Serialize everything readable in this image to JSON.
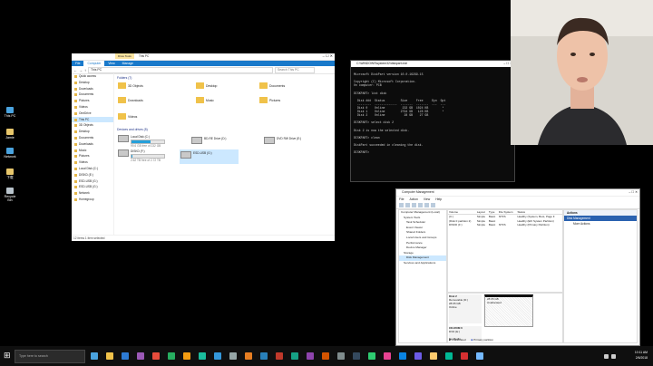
{
  "desktop": {
    "icons": [
      {
        "label": "This PC",
        "color": "#4aa3df"
      },
      {
        "label": "Jamie",
        "color": "#e7c66b"
      },
      {
        "label": "Network",
        "color": "#4aa3df"
      },
      {
        "label": "下载",
        "color": "#e7c66b"
      },
      {
        "label": "Recycle Bin",
        "color": "#b9c4cc"
      }
    ]
  },
  "explorer": {
    "title": "This PC",
    "ribbon_tabs": [
      "File",
      "Computer",
      "View",
      "Manage"
    ],
    "drive_tools_label": "Drive Tools",
    "address": "This PC",
    "search_placeholder": "Search This PC",
    "nav": [
      "Quick access",
      "Desktop",
      "Downloads",
      "Documents",
      "Pictures",
      "Videos",
      "OneDrive",
      "This PC",
      "3D Objects",
      "Desktop",
      "Documents",
      "Downloads",
      "Music",
      "Pictures",
      "Videos",
      "Local Disk (C:)",
      "DISKD (E:)",
      "ESD-USB (G:)",
      "ESD-USB (G:)",
      "Network",
      "Homegroup"
    ],
    "folders_header": "Folders (7)",
    "folders": [
      "3D Objects",
      "Desktop",
      "Documents",
      "Downloads",
      "Music",
      "Pictures",
      "Videos"
    ],
    "devices_header": "Devices and drives (5)",
    "drives": [
      {
        "name": "Local Disk (C:)",
        "free": "99.6 GB free of 232 GB",
        "fill": 0.57
      },
      {
        "name": "BD-RE Drive (D:)",
        "free": "",
        "fill": null
      },
      {
        "name": "DVD RW Drive (E:)",
        "free": "",
        "fill": null
      },
      {
        "name": "DISKD (F:)",
        "free": "2.62 TB free of 2.72 TB",
        "fill": 0.04
      },
      {
        "name": "ESD-USB (G:)",
        "free": "",
        "fill": null
      }
    ],
    "status": "12 items    1 item selected"
  },
  "cmd": {
    "title": "C:\\WINDOWS\\system32\\diskpart.exe",
    "lines": [
      "",
      "Microsoft DiskPart version 10.0.16299.15",
      "",
      "Copyright (C) Microsoft Corporation.",
      "On computer: PCB",
      "",
      "DISKPART> list disk",
      "",
      "  Disk ###  Status         Size     Free     Dyn  Gpt",
      "  --------  -------------  -------  -------  ---  ---",
      "  Disk 0    Online          232 GB  1024 KB        *",
      "  Disk 1    Online         2794 GB   128 KB        *",
      "  Disk 2    Online           28 GB    27 GB",
      "",
      "DISKPART> select disk 2",
      "",
      "Disk 2 is now the selected disk.",
      "",
      "DISKPART> clean",
      "",
      "DiskPart succeeded in cleaning the disk.",
      "",
      "DISKPART> "
    ]
  },
  "comp_mgmt": {
    "title": "Computer Management",
    "menu": [
      "File",
      "Action",
      "View",
      "Help"
    ],
    "tree": [
      "Computer Management (Local)",
      "System Tools",
      "Task Scheduler",
      "Event Viewer",
      "Shared Folders",
      "Local Users and Groups",
      "Performance",
      "Device Manager",
      "Storage",
      "Disk Management",
      "Services and Applications"
    ],
    "columns": [
      "Volume",
      "Layout",
      "Type",
      "File System",
      "Status"
    ],
    "rows": [
      [
        "(C:)",
        "Simple",
        "Basic",
        "NTFS",
        "Healthy (System, Boot, Page F"
      ],
      [
        "(Disk 0 partition 2)",
        "Simple",
        "Basic",
        "",
        "Healthy (EFI System Partition)"
      ],
      [
        "DISKD (F:)",
        "Simple",
        "Basic",
        "NTFS",
        "Healthy (Primary Partition)"
      ]
    ],
    "disk2": {
      "label": "Disk 2",
      "type": "Removable (D:)",
      "size": "28.65 GB",
      "state": "Online",
      "part_size": "28.65 GB",
      "part_state": "Unallocated"
    },
    "cdrom": {
      "label": "CD-ROM 0",
      "type": "DVD (E:)",
      "media": "No Media"
    },
    "legend": [
      "Unallocated",
      "Primary partition"
    ],
    "actions_header": "Actions",
    "actions": [
      "Disk Management",
      "More Actions"
    ]
  },
  "taskbar": {
    "search_placeholder": "Type here to search",
    "time": "10:11 AM",
    "date": "2/6/2018"
  },
  "colors": {
    "accent": "#1979ca",
    "selected": "#cce8ff",
    "drive_fill": "#26a0da"
  }
}
